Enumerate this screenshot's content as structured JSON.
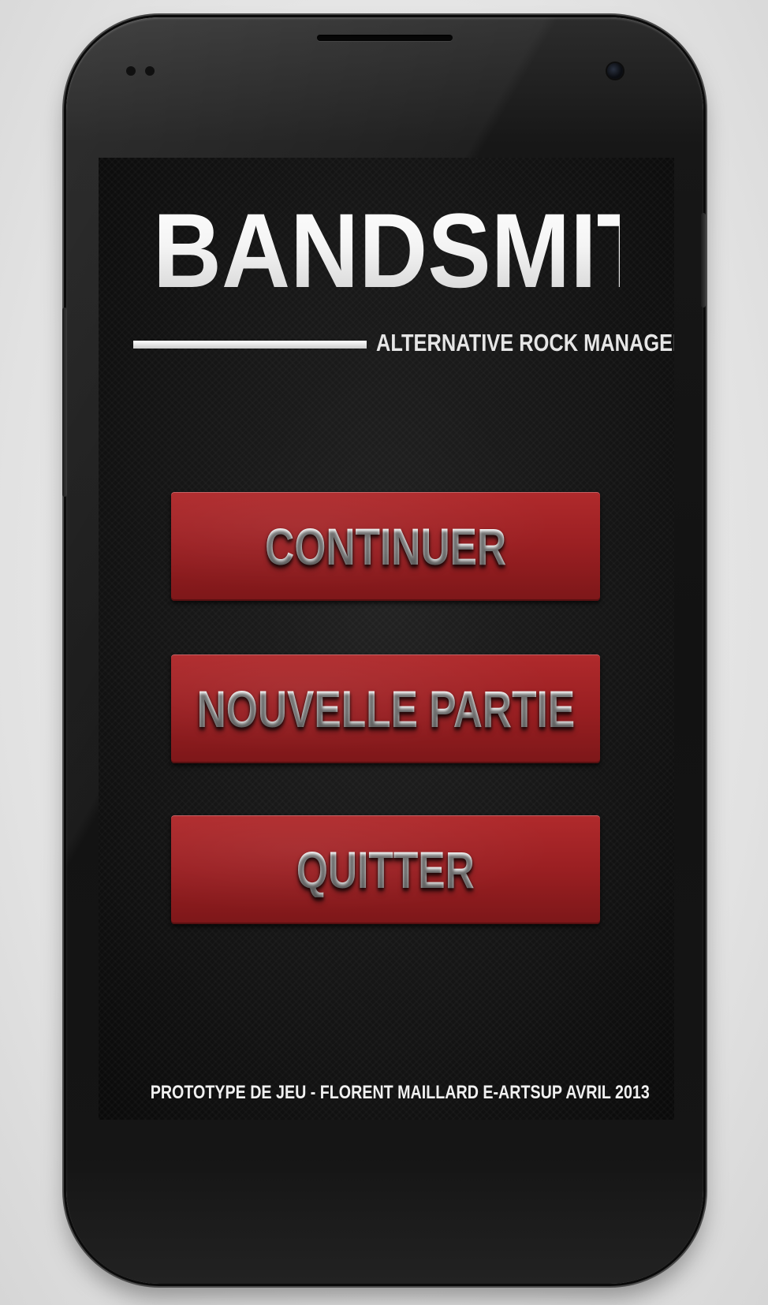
{
  "app": {
    "title": "BANDSMITH",
    "subtitle": "ALTERNATIVE ROCK MANAGER"
  },
  "menu": {
    "items": [
      {
        "label": "CONTINUER"
      },
      {
        "label": "NOUVELLE PARTIE"
      },
      {
        "label": "QUITTER"
      }
    ]
  },
  "footer": {
    "credit": "PROTOTYPE DE JEU - FLORENT MAILLARD E-ARTSUP AVRIL 2013"
  },
  "colors": {
    "button_red": "#9a1f22",
    "screen_background": "#141414",
    "text": "#f2f2f2"
  }
}
